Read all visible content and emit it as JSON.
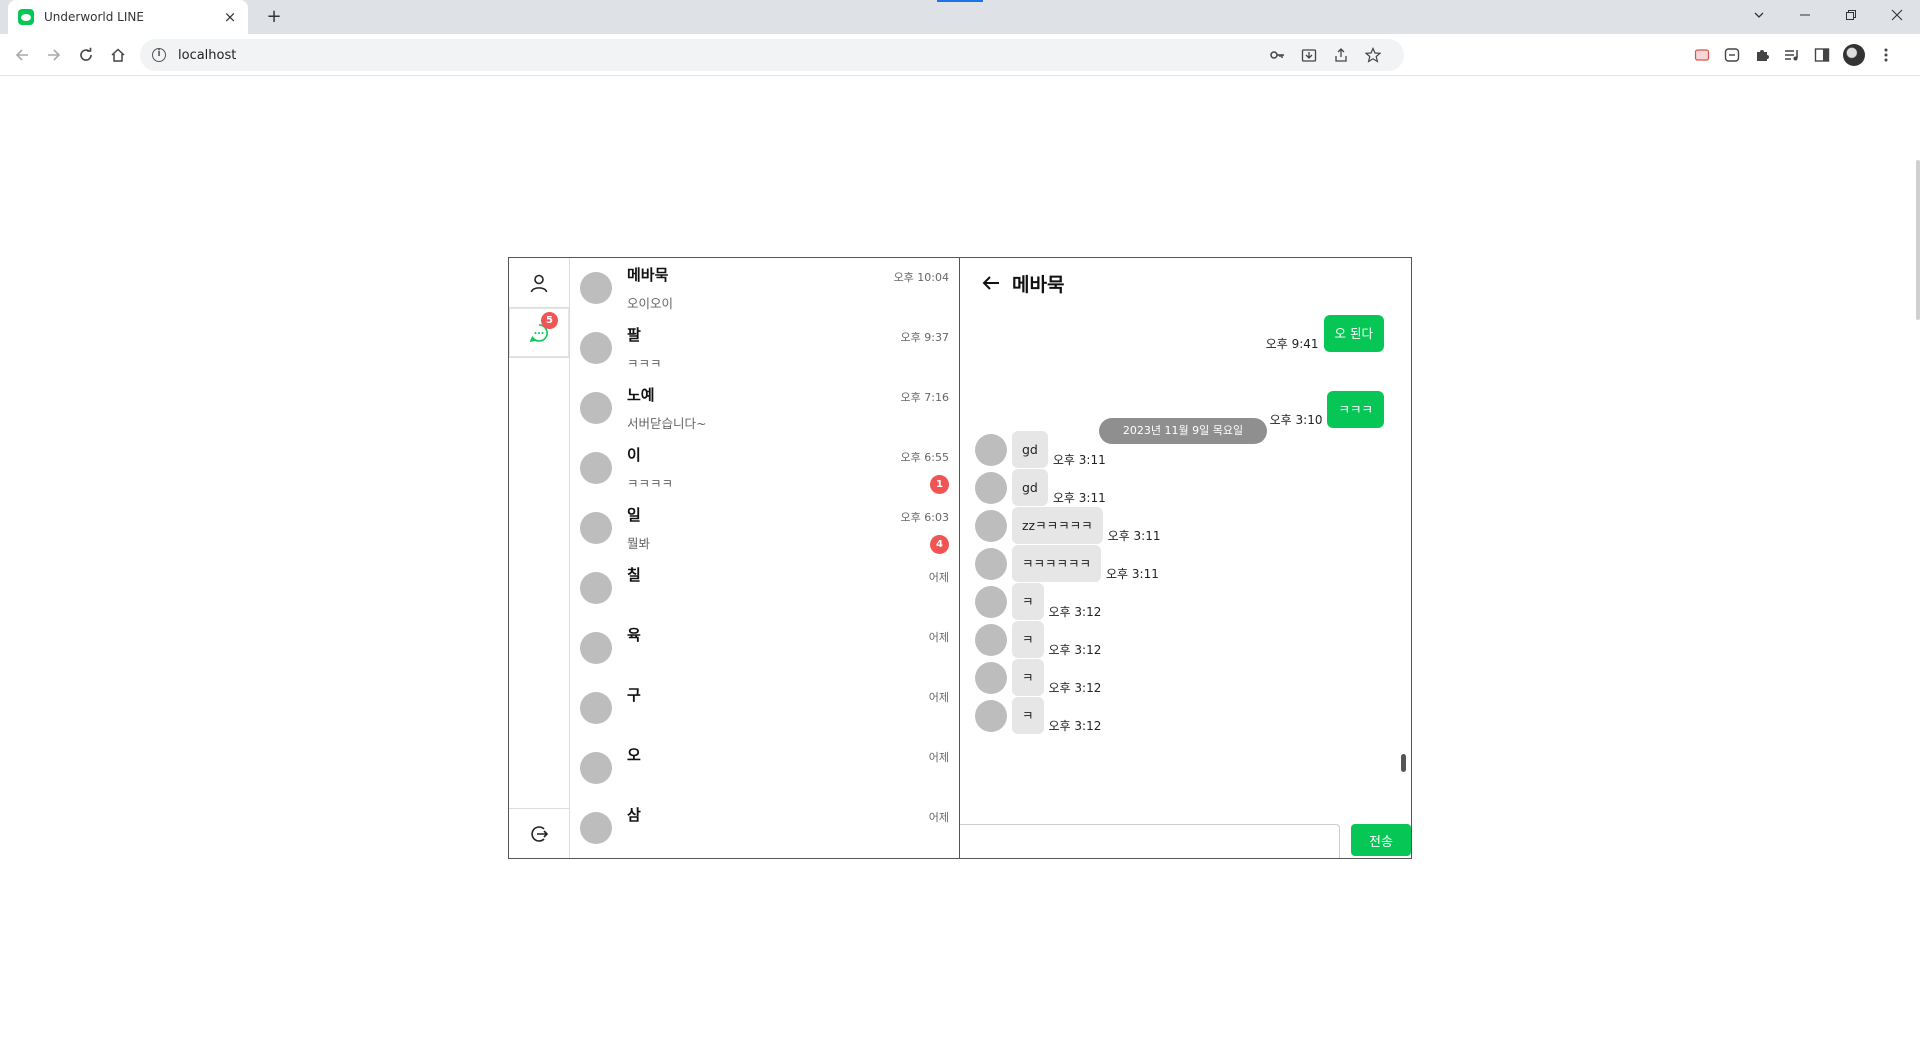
{
  "browser": {
    "tab_title": "Underworld LINE",
    "url": "localhost",
    "new_tab": "+",
    "close": "×"
  },
  "sidebar": {
    "chat_badge": "5"
  },
  "rooms": [
    {
      "name": "메바묵",
      "preview": "오이오이",
      "time": "오후 10:04",
      "badge": ""
    },
    {
      "name": "팔",
      "preview": "ㅋㅋㅋ",
      "time": "오후 9:37",
      "badge": ""
    },
    {
      "name": "노예",
      "preview": "서버닫습니다~",
      "time": "오후 7:16",
      "badge": ""
    },
    {
      "name": "이",
      "preview": "ㅋㅋㅋㅋ",
      "time": "오후 6:55",
      "badge": "1"
    },
    {
      "name": "일",
      "preview": "뭘봐",
      "time": "오후 6:03",
      "badge": "4"
    },
    {
      "name": "칠",
      "preview": "",
      "time": "어제",
      "badge": ""
    },
    {
      "name": "육",
      "preview": "",
      "time": "어제",
      "badge": ""
    },
    {
      "name": "구",
      "preview": "",
      "time": "어제",
      "badge": ""
    },
    {
      "name": "오",
      "preview": "",
      "time": "어제",
      "badge": ""
    },
    {
      "name": "삼",
      "preview": "",
      "time": "어제",
      "badge": ""
    }
  ],
  "chat": {
    "title": "메바묵",
    "date_divider": "2023년 11월 9일 목요일",
    "messages": [
      {
        "mine": true,
        "text": "오 된다",
        "time": "오후 9:41"
      },
      {
        "mine": true,
        "text": "ㅋㅋㅋ",
        "time": "오후 3:10"
      },
      {
        "mine": false,
        "text": "gd",
        "time": "오후 3:11"
      },
      {
        "mine": false,
        "text": "gd",
        "time": "오후 3:11"
      },
      {
        "mine": false,
        "text": "zzㅋㅋㅋㅋㅋ",
        "time": "오후 3:11"
      },
      {
        "mine": false,
        "text": "ㅋㅋㅋㅋㅋㅋ",
        "time": "오후 3:11"
      },
      {
        "mine": false,
        "text": "ㅋ",
        "time": "오후 3:12"
      },
      {
        "mine": false,
        "text": "ㅋ",
        "time": "오후 3:12"
      },
      {
        "mine": false,
        "text": "ㅋ",
        "time": "오후 3:12"
      },
      {
        "mine": false,
        "text": "ㅋ",
        "time": "오후 3:12"
      }
    ],
    "input_value": "",
    "send_label": "전송"
  },
  "colors": {
    "accent": "#06c755",
    "badge": "#f05454",
    "date_pill": "#8f8f8f"
  }
}
